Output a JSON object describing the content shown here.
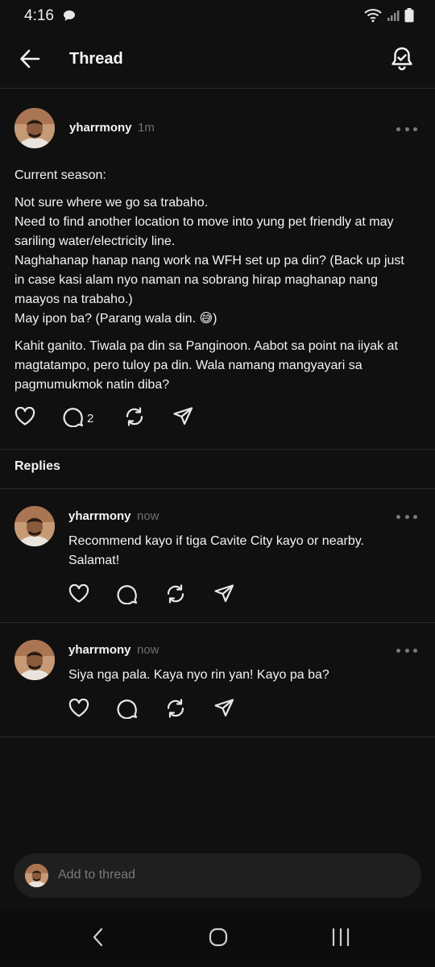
{
  "status_bar": {
    "time": "4:16"
  },
  "header": {
    "title": "Thread"
  },
  "post": {
    "username": "yharrmony",
    "time": "1m",
    "paragraphs": [
      "Current season:",
      "Not sure where we go sa trabaho.\nNeed to find another location to move into yung pet friendly at may sariling water/electricity line.\nNaghahanap hanap nang work na WFH set up pa din? (Back up just in case kasi alam nyo naman na sobrang hirap maghanap nang maayos na trabaho.)\nMay ipon ba? (Parang wala din. 😅)",
      "Kahit ganito. Tiwala pa din sa Panginoon. Aabot sa point na iiyak at magtatampo, pero tuloy pa din. Wala namang mangyayari sa pagmumukmok natin diba?"
    ],
    "reply_count": "2"
  },
  "replies_label": "Replies",
  "replies": [
    {
      "username": "yharrmony",
      "time": "now",
      "text": "Recommend kayo if tiga Cavite City kayo or nearby. Salamat!"
    },
    {
      "username": "yharrmony",
      "time": "now",
      "text": "Siya nga pala. Kaya nyo rin yan! Kayo pa ba?"
    }
  ],
  "composer": {
    "placeholder": "Add to thread"
  },
  "icons": {
    "back": "arrow-left-icon",
    "bell": "bell-check-icon",
    "more": "more-horizontal-icon",
    "like": "heart-icon",
    "comment": "comment-icon",
    "repost": "repost-icon",
    "share": "send-icon",
    "nav_back": "chevron-left-icon",
    "nav_home": "home-circle-icon",
    "nav_recent": "recents-icon"
  },
  "colors": {
    "background": "#101010",
    "text": "#f3f3f3",
    "muted": "#6f6f6f",
    "composer_bg": "#1f1f1f"
  }
}
